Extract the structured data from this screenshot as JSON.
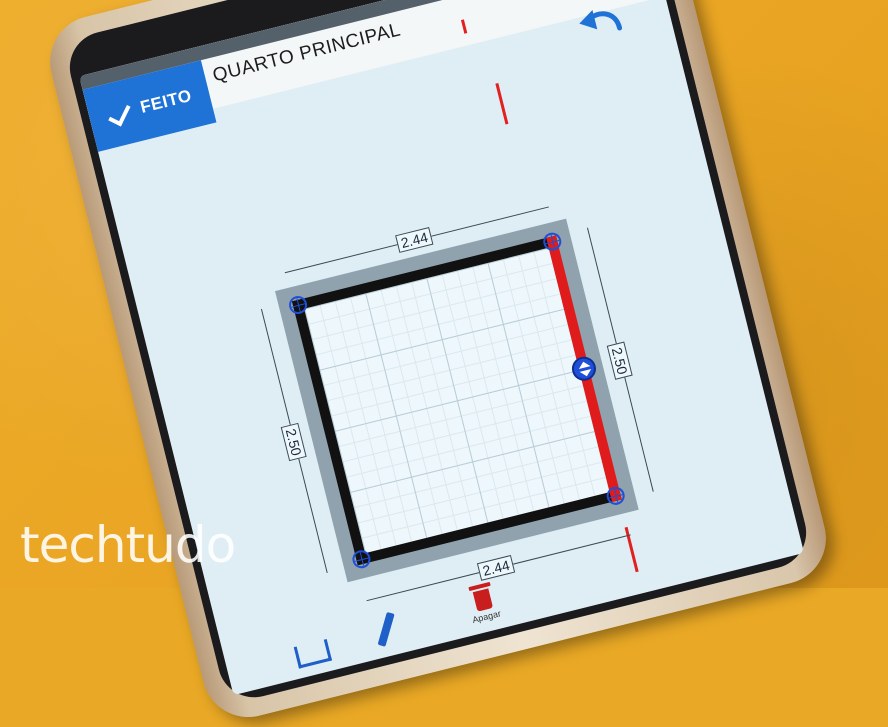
{
  "topbar": {
    "done_label": "FEITO",
    "room_title": "QUARTO PRINCIPAL"
  },
  "dimensions": {
    "top": "2.44",
    "bottom": "2.44",
    "left": "2.50",
    "right": "2.50"
  },
  "toolbar": {
    "delete_label": "Apagar"
  },
  "watermark": "techtudo",
  "colors": {
    "accent": "#1f73d6",
    "selected_wall": "#e01b1b",
    "wall": "#111111",
    "handle": "#1f4fd6"
  }
}
